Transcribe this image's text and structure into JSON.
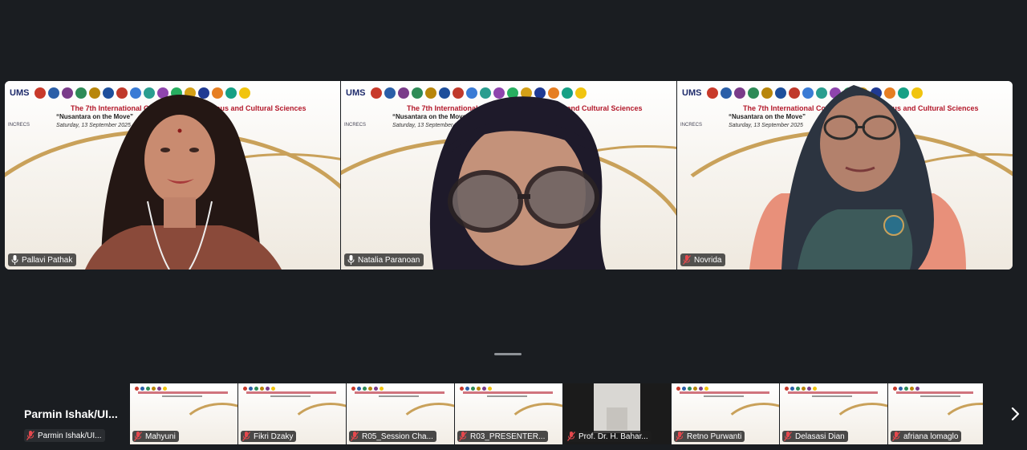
{
  "main_tiles": [
    {
      "name": "Pallavi Pathak",
      "muted": false
    },
    {
      "name": "Natalia Paranoan",
      "muted": false,
      "active_speaker": true
    },
    {
      "name": "Novrida",
      "muted": true
    }
  ],
  "banner": {
    "org": "UMS",
    "conference": "The 7th International Conference on Religious and Cultural Sciences",
    "theme": "“Nusantara on the Move”",
    "date": "Saturday, 13 September 2025",
    "sub_org": "INCRECS"
  },
  "self_view": {
    "display_name": "Parmin  Ishak/UI...",
    "tag_label": "Parmin Ishak/UI..."
  },
  "thumbnails": [
    {
      "name": "Mahyuni"
    },
    {
      "name": "Fikri Dzaky"
    },
    {
      "name": "R05_Session Cha..."
    },
    {
      "name": "R03_PRESENTER..."
    },
    {
      "name": "Prof. Dr. H. Bahar..."
    },
    {
      "name": "Retno Purwanti"
    },
    {
      "name": "Delasasi Dian"
    },
    {
      "name": "afriana lomaglo"
    }
  ],
  "icons": {
    "mic_on": "microphone-icon",
    "mic_off": "microphone-muted-icon",
    "next": "chevron-right-icon"
  },
  "colors": {
    "background": "#1a1d21",
    "active_border": "#3ecf8e",
    "muted_red": "#e5484d"
  }
}
